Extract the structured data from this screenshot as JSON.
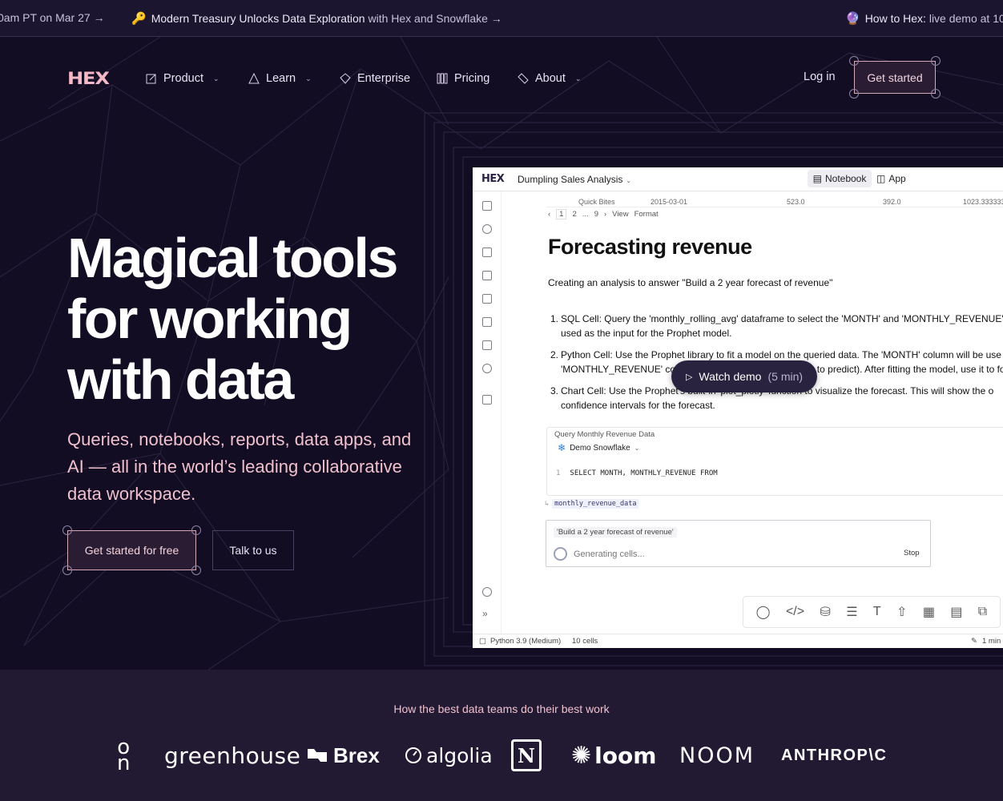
{
  "ticker": {
    "items": [
      {
        "icon": "",
        "text": "0am PT on Mar 27 →"
      },
      {
        "icon": "key-icon",
        "strong": "Modern Treasury Unlocks Data Exploration",
        "text": " with Hex and Snowflake →"
      },
      {
        "icon": "crystal-ball-icon",
        "strong": "How to Hex:",
        "text": " live demo at 10"
      }
    ]
  },
  "nav": {
    "logo": "HEX",
    "items": [
      {
        "label": "Product",
        "dropdown": true,
        "icon": "edit-icon"
      },
      {
        "label": "Learn",
        "dropdown": true,
        "icon": "triangle-icon"
      },
      {
        "label": "Enterprise",
        "dropdown": false,
        "icon": "diamond-icon"
      },
      {
        "label": "Pricing",
        "dropdown": false,
        "icon": "bars-icon"
      },
      {
        "label": "About",
        "dropdown": true,
        "icon": "tag-icon"
      }
    ],
    "login": "Log in",
    "cta": "Get started"
  },
  "hero": {
    "title": "Magical tools for working with data",
    "subtitle": "Queries, notebooks, reports, data apps, and AI — all in the world’s leading collaborative data workspace.",
    "primary_cta": "Get started for free",
    "secondary_cta": "Talk to us"
  },
  "app": {
    "logo": "HEX",
    "project_title": "Dumpling Sales Analysis",
    "tabs": [
      "Notebook",
      "App"
    ],
    "strip": [
      "Quick Bites",
      "2015-03-01",
      "523.0",
      "392.0",
      "1023.3333333"
    ],
    "pager": {
      "prev": "‹",
      "current": "1",
      "p2": "2",
      "ellipsis": "...",
      "last": "9",
      "next": "›",
      "view": "View",
      "format": "Format"
    },
    "heading": "Forecasting revenue",
    "intro": "Creating an analysis to answer \"Build a 2 year forecast of revenue\"",
    "steps": [
      "SQL Cell: Query the 'monthly_rolling_avg' dataframe to select the 'MONTH' and 'MONTHLY_REVENUE' c used as the input for the Prophet model.",
      "Python Cell: Use the Prophet library to fit a model on the queried data. The 'MONTH' column will be use 'MONTHLY_REVENUE' column will be used as the y (value to predict). After fitting the model, use it to fo",
      "Chart Cell: Use the Prophet's built-in 'plot_plotly' function to visualize the forecast. This will show the o confidence intervals for the forecast."
    ],
    "cell_label": "Query Monthly Revenue Data",
    "connection": "Demo Snowflake",
    "code_line": "1",
    "code": "SELECT MONTH, MONTHLY_REVENUE FROM",
    "dataframe": "monthly_revenue_data",
    "prompt": "'Build a 2 year forecast of revenue'",
    "generating": "Generating cells...",
    "stop": "Stop",
    "runtime": "Python 3.9 (Medium)",
    "cells": "10 cells",
    "edited": "1 min"
  },
  "watch": {
    "label": "Watch demo",
    "duration": "(5 min)"
  },
  "logos": {
    "tagline": "How the best data teams do their best work",
    "brands": [
      "On",
      "greenhouse",
      "Brex",
      "algolia",
      "N",
      "loom",
      "NOOM",
      "ANTHROP\\C"
    ]
  },
  "colors": {
    "bg": "#120d22",
    "accent": "#f0c0cd",
    "band": "#221a33"
  }
}
